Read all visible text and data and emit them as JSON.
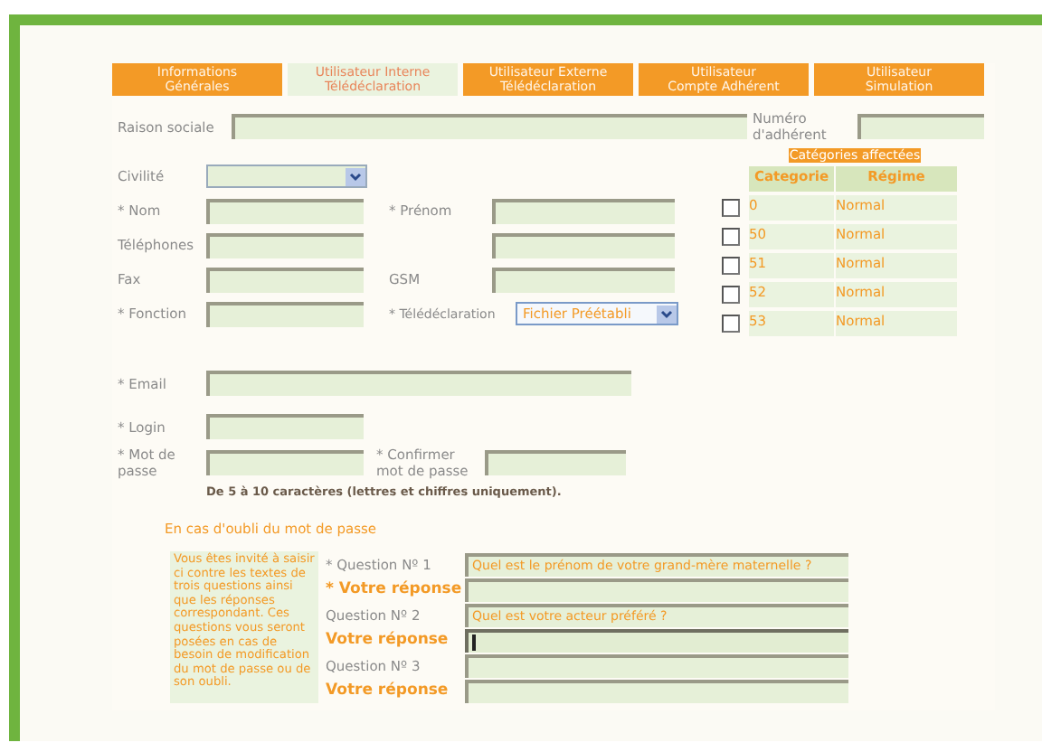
{
  "tabs": [
    {
      "lines": [
        "Informations",
        "Générales"
      ],
      "selected": false
    },
    {
      "lines": [
        "Utilisateur Interne",
        "Télédéclaration"
      ],
      "selected": true
    },
    {
      "lines": [
        "Utilisateur Externe",
        "Télédéclaration"
      ],
      "selected": false
    },
    {
      "lines": [
        "Utilisateur",
        "Compte Adhérent"
      ],
      "selected": false
    },
    {
      "lines": [
        "Utilisateur",
        "Simulation"
      ],
      "selected": false
    }
  ],
  "raison_sociale": {
    "label": "Raison sociale"
  },
  "numero_adherent": {
    "label": "Numéro d'adhérent"
  },
  "civilite": {
    "label": "Civilité"
  },
  "identity_rows": [
    {
      "label": "* Nom",
      "second": {
        "kind": "text",
        "label": "* Prénom"
      }
    },
    {
      "label": "Téléphones",
      "second": {
        "kind": "text"
      }
    },
    {
      "label": "Fax",
      "second": {
        "kind": "text",
        "label": "GSM"
      }
    },
    {
      "label": "* Fonction",
      "second": {
        "kind": "select",
        "label": "* Télédéclaration",
        "value": "Fichier Préétabli"
      }
    }
  ],
  "email": {
    "label": "* Email"
  },
  "login": {
    "label": "* Login"
  },
  "password": {
    "label": "* Mot de passe",
    "confirm_label": "* Confirmer mot de passe",
    "hint": "De 5 à 10  caractères (lettres et chiffres uniquement)."
  },
  "categories": {
    "title": "Catégories affectées",
    "columns": [
      "Categorie",
      "Régime"
    ],
    "rows": [
      {
        "category": "0",
        "regime": "Normal",
        "checked": false
      },
      {
        "category": "50",
        "regime": "Normal",
        "checked": false
      },
      {
        "category": "51",
        "regime": "Normal",
        "checked": false
      },
      {
        "category": "52",
        "regime": "Normal",
        "checked": false
      },
      {
        "category": "53",
        "regime": "Normal",
        "checked": false
      }
    ]
  },
  "recovery": {
    "title": "En cas d'oubli du mot de passe",
    "note": "Vous êtes invité à saisir ci contre les textes de trois questions ainsi que les réponses correspondant. Ces questions vous seront posées en cas de besoin de modification du mot de passe ou de son oubli.",
    "items": [
      {
        "kind": "question",
        "label": "* Question Nº 1",
        "value": "Quel est le prénom de votre grand-mère maternelle ?"
      },
      {
        "kind": "answer",
        "label": "* Votre réponse",
        "focused": false
      },
      {
        "kind": "question",
        "label": "Question Nº 2",
        "value": "Quel est votre acteur  préféré ?"
      },
      {
        "kind": "answer",
        "label": "Votre réponse",
        "focused": true
      },
      {
        "kind": "question",
        "label": "Question Nº 3"
      },
      {
        "kind": "answer",
        "label": "Votre réponse",
        "focused": false
      }
    ]
  }
}
